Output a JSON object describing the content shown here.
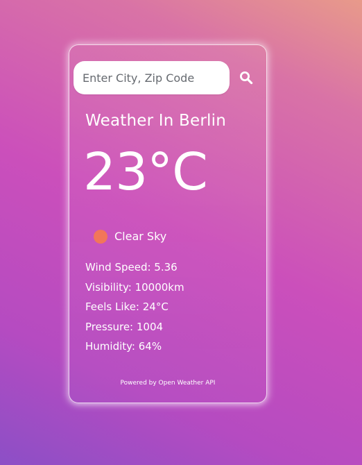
{
  "search": {
    "placeholder": "Enter City, Zip Code",
    "value": ""
  },
  "icons": {
    "search": "search-icon",
    "condition": "clear-sky-icon"
  },
  "weather": {
    "title": "Weather In Berlin",
    "temperature": "23°C",
    "condition": "Clear Sky",
    "stats": [
      "Wind Speed: 5.36",
      "Visibility: 10000km",
      "Feels Like: 24°C",
      "Pressure: 1004",
      "Humidity: 64%"
    ]
  },
  "footer": {
    "text": "Powered by Open Weather API"
  },
  "colors": {
    "condition_icon": "#f2765a",
    "text": "#ffffff"
  }
}
